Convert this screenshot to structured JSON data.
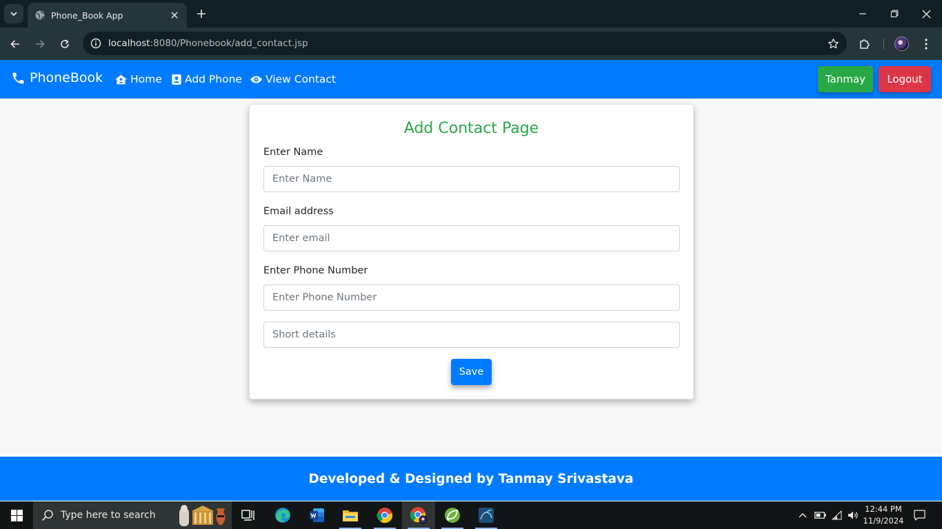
{
  "browser": {
    "tab_title": "Phone_Book App",
    "url_host": "localhost",
    "url_path": ":8080/Phonebook/add_contact.jsp"
  },
  "navbar": {
    "brand": "PhoneBook",
    "links": [
      {
        "label": "Home",
        "icon": "home-icon"
      },
      {
        "label": "Add Phone",
        "icon": "contact-book-icon"
      },
      {
        "label": "View Contact",
        "icon": "eye-icon"
      }
    ],
    "user_label": "Tanmay",
    "logout_label": "Logout",
    "colors": {
      "primary": "#007bff",
      "success": "#28a745",
      "danger": "#dc3545"
    }
  },
  "form": {
    "title": "Add Contact Page",
    "name_label": "Enter Name",
    "name_placeholder": "Enter Name",
    "email_label": "Email address",
    "email_placeholder": "Enter email",
    "phone_label": "Enter Phone Number",
    "phone_placeholder": "Enter Phone Number",
    "details_placeholder": "Short details",
    "save_label": "Save"
  },
  "footer": {
    "text": "Developed & Designed by Tanmay Srivastava"
  },
  "taskbar": {
    "search_placeholder": "Type here to search",
    "apps": [
      "task-view-icon",
      "edge-icon",
      "word-icon",
      "file-explorer-icon",
      "chrome-icon",
      "chrome-profile-icon",
      "spring-tool-icon",
      "mysql-workbench-icon"
    ],
    "time": "12:44 PM",
    "date": "11/9/2024"
  }
}
